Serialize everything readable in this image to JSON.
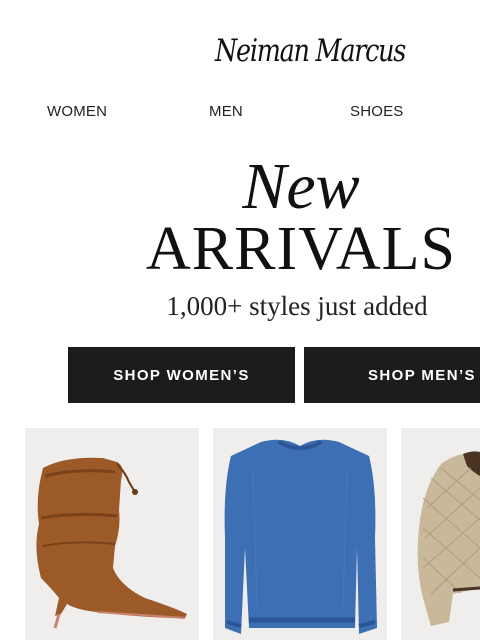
{
  "brand": {
    "logo_text": "Neiman Marcus"
  },
  "nav": {
    "items": [
      {
        "label": "WOMEN"
      },
      {
        "label": "MEN"
      },
      {
        "label": "SHOES"
      }
    ]
  },
  "hero": {
    "line1": "New",
    "line2": "ARRIVALS",
    "subtitle": "1,000+ styles just added"
  },
  "cta": {
    "women_label": "SHOP WOMEN’S",
    "men_label": "SHOP MEN’S"
  },
  "products": [
    {
      "icon": "suede-slouch-boot-image",
      "color": "#9c5a28"
    },
    {
      "icon": "blue-knit-sweater-image",
      "color": "#3d6fb5"
    },
    {
      "icon": "quilted-jacket-image",
      "color": "#c9b89a"
    }
  ],
  "colors": {
    "cta_background": "#1c1c1c",
    "cta_text": "#ffffff",
    "product_background": "#efeeec"
  }
}
